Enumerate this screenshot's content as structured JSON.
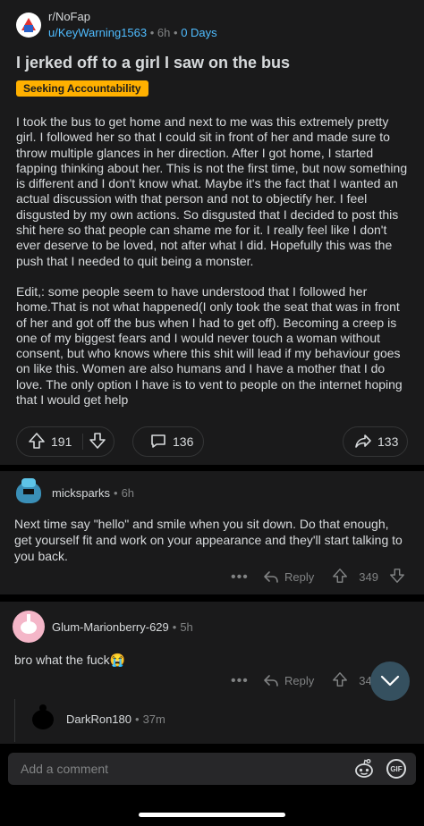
{
  "post": {
    "subreddit": "r/NoFap",
    "author": "u/KeyWarning1563",
    "age": "6h",
    "badge": "0 Days",
    "separator": "•",
    "title": "I jerked off to a girl I saw on the bus",
    "flair": "Seeking Accountability",
    "body_paragraphs": [
      "I took the bus to get home and next to me was this extremely pretty girl. I followed her so that I could sit in front of her and made sure to throw multiple glances in her direction. After I got home, I started fapping thinking about her. This is not the first time, but now something is different and I don't know what. Maybe it's the fact that I wanted an actual discussion with that person and not to objectify her. I feel disgusted by my own actions. So disgusted that I decided to post this shit here so that people can shame me for it. I really feel like I don't ever deserve to be loved, not after what I did. Hopefully this was the push that I needed to quit being a monster.",
      "Edit,: some people seem to have understood that I followed her home.That is not what happened(I only took the seat that was in front of her and got off the bus when I had to get off). Becoming a creep is one of my biggest fears and I would never touch a woman without consent, but who knows where this shit will lead if my behaviour goes on like this. Women are also humans and I have a mother that I do love. The only option I have is to vent to people on the internet hoping that I would get help"
    ],
    "upvotes": "191",
    "comments": "136",
    "shares": "133"
  },
  "comments": [
    {
      "username": "micksparks",
      "age": "6h",
      "text": "Next time say \"hello\" and smile when you sit down. Do that enough, get yourself fit and work on your appearance and they'll start talking to you back.",
      "more": "•••",
      "reply_label": "Reply",
      "score": "349"
    },
    {
      "username": "Glum-Marionberry-629",
      "age": "5h",
      "text": "bro what the fuck😭",
      "more": "•••",
      "reply_label": "Reply",
      "score": "34"
    }
  ],
  "nested_reply": {
    "username": "DarkRon180",
    "age": "37m"
  },
  "composer": {
    "placeholder": "Add a comment",
    "gif_label": "GIF"
  },
  "colors": {
    "accent_blue": "#4fbcff",
    "flair_bg": "#ffb000",
    "surface": "#1a1a1b"
  }
}
